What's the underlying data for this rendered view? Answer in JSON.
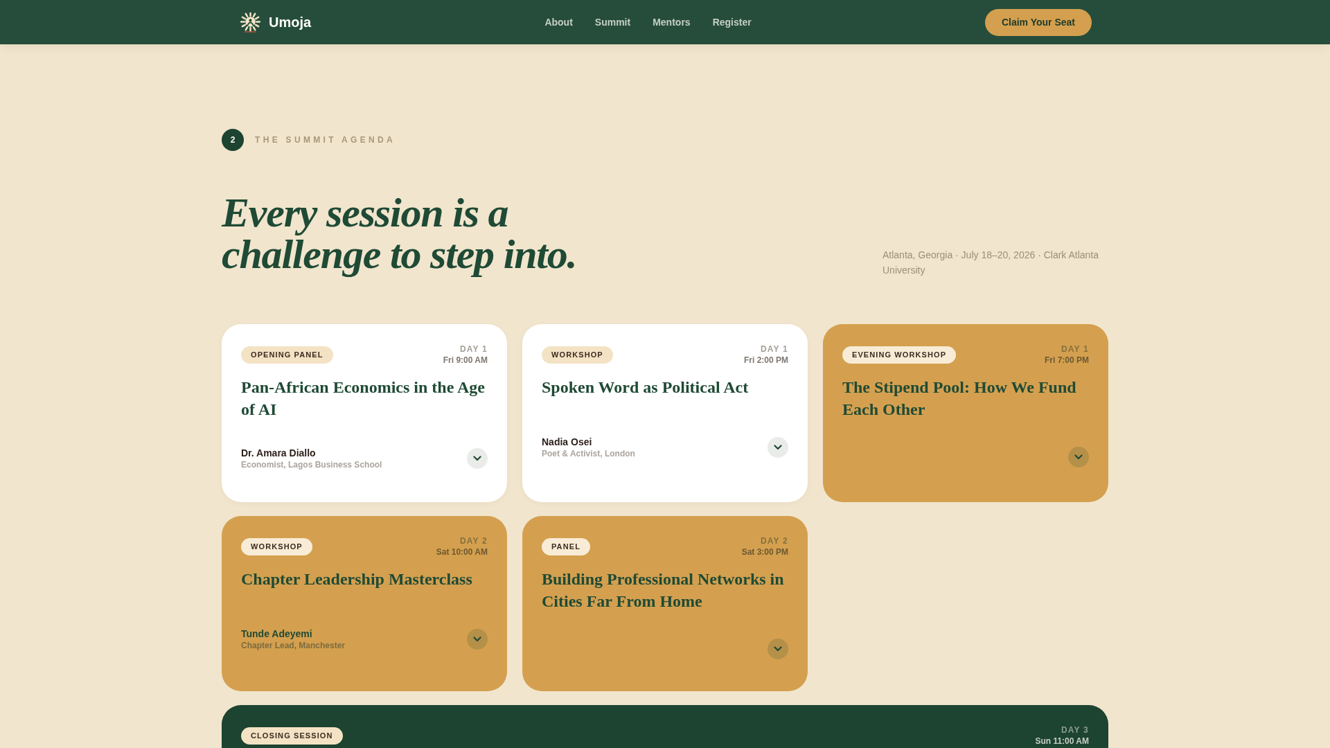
{
  "nav": {
    "brand": "Umoja",
    "links": [
      "About",
      "Summit",
      "Mentors",
      "Register"
    ],
    "cta": "Claim Your Seat"
  },
  "section": {
    "number": "2",
    "eyebrow": "THE SUMMIT AGENDA",
    "heading": "Every session is a challenge to step into.",
    "meta": "Atlanta, Georgia · July 18–20, 2026 · Clark Atlanta University"
  },
  "sessions": [
    {
      "kind": "light",
      "tag": "OPENING PANEL",
      "day": "DAY 1",
      "time": "Fri 9:00 AM",
      "title": "Pan-African Economics in the Age of AI",
      "speaker": {
        "name": "Dr. Amara Diallo",
        "role": "Economist, Lagos Business School"
      }
    },
    {
      "kind": "light",
      "tag": "WORKSHOP",
      "day": "DAY 1",
      "time": "Fri 2:00 PM",
      "title": "Spoken Word as Political Act",
      "speaker": {
        "name": "Nadia Osei",
        "role": "Poet & Activist, London"
      }
    },
    {
      "kind": "gold",
      "tag": "EVENING WORKSHOP",
      "day": "DAY 1",
      "time": "Fri 7:00 PM",
      "title": "The Stipend Pool: How We Fund Each Other"
    },
    {
      "kind": "gold",
      "tag": "WORKSHOP",
      "day": "DAY 2",
      "time": "Sat 10:00 AM",
      "title": "Chapter Leadership Masterclass",
      "speaker": {
        "name": "Tunde Adeyemi",
        "role": "Chapter Lead, Manchester"
      }
    },
    {
      "kind": "gold",
      "tag": "PANEL",
      "day": "DAY 2",
      "time": "Sat 3:00 PM",
      "title": "Building Professional Networks in Cities Far From Home"
    },
    {
      "kind": "dark",
      "tag": "CLOSING SESSION",
      "day": "DAY 3",
      "time": "Sun 11:00 AM"
    }
  ]
}
